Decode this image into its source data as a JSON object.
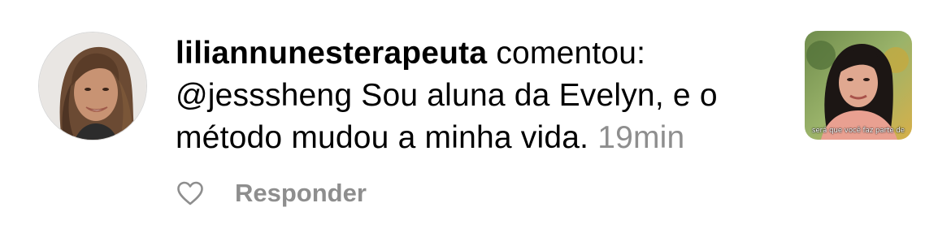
{
  "comment": {
    "username": "liliannunesterapeuta",
    "verb": "comentou:",
    "mention": "@jesssheng",
    "text": "Sou aluna da Evelyn, e o método mudou a minha vida.",
    "time": "19min"
  },
  "thumbnail": {
    "caption": "será que você faz parte de"
  },
  "actions": {
    "like_icon": "heart-outline-icon",
    "reply_label": "Responder"
  },
  "colors": {
    "secondary_text": "#8e8e8e",
    "primary_text": "#000000",
    "background": "#ffffff"
  }
}
